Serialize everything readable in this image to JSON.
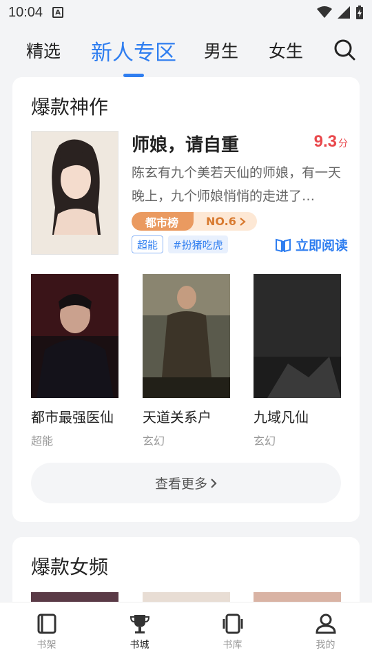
{
  "status": {
    "time": "10:04"
  },
  "tabs": [
    {
      "label": "精选"
    },
    {
      "label": "新人专区"
    },
    {
      "label": "男生"
    },
    {
      "label": "女生"
    }
  ],
  "section1": {
    "title": "爆款神作",
    "featured": {
      "title": "师娘，请自重",
      "score": "9.3",
      "score_unit": "分",
      "description": "陈玄有九个美若天仙的师娘，有一天晚上，九个师娘悄悄的走进了…",
      "rank_name": "都市榜",
      "rank_no": "NO.6",
      "tags": [
        "超能",
        "#扮猪吃虎"
      ],
      "read_label": "立即阅读"
    },
    "books": [
      {
        "name": "都市最强医仙",
        "genre": "超能"
      },
      {
        "name": "天道关系户",
        "genre": "玄幻"
      },
      {
        "name": "九域凡仙",
        "genre": "玄幻"
      }
    ],
    "more_label": "查看更多"
  },
  "section2": {
    "title": "爆款女频"
  },
  "bottom_nav": [
    {
      "label": "书架"
    },
    {
      "label": "书城"
    },
    {
      "label": "书库"
    },
    {
      "label": "我的"
    }
  ],
  "colors": {
    "accent": "#2f7ef0",
    "score": "#e9484c",
    "rank": "#ea9a60"
  }
}
